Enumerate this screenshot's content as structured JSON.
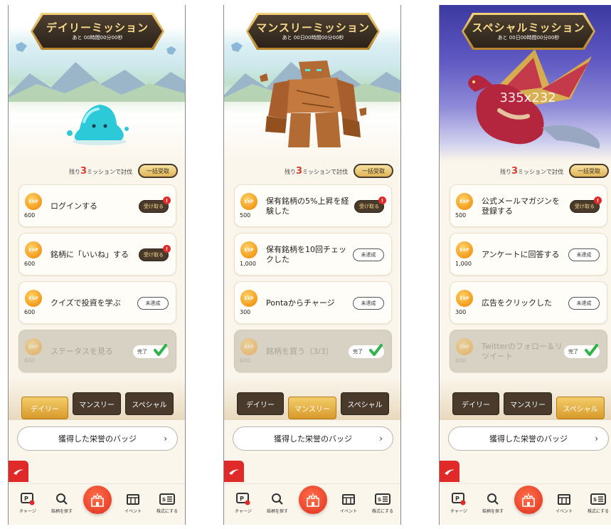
{
  "phones": [
    {
      "banner_title": "デイリーミッション",
      "banner_sub": "あと 00時間00分00秒",
      "remain_prefix": "残り",
      "remain_count": "3",
      "remain_suffix": "ミッションで討伐",
      "bulk_label": "一括受取",
      "missions": [
        {
          "exp": "600",
          "title": "ログインする",
          "status": "受け取る",
          "state": "receive"
        },
        {
          "exp": "600",
          "title": "銘柄に「いいね」する",
          "status": "受け取る",
          "state": "receive"
        },
        {
          "exp": "600",
          "title": "クイズで投資を学ぶ",
          "status": "未達成",
          "state": "pending"
        },
        {
          "exp": "600",
          "title": "ステータスを見る",
          "status": "完了",
          "state": "complete"
        }
      ],
      "active_tab": 0
    },
    {
      "banner_title": "マンスリーミッション",
      "banner_sub": "あと 00日00時間00分00秒",
      "remain_prefix": "残り",
      "remain_count": "3",
      "remain_suffix": "ミッションで討伐",
      "bulk_label": "一括受取",
      "missions": [
        {
          "exp": "500",
          "title": "保有銘柄の5%上昇を経験した",
          "status": "受け取る",
          "state": "receive"
        },
        {
          "exp": "1,000",
          "title": "保有銘柄を10回チェックした",
          "status": "未達成",
          "state": "pending"
        },
        {
          "exp": "300",
          "title": "Pontaからチャージ",
          "status": "未達成",
          "state": "pending"
        },
        {
          "exp": "600",
          "title": "銘柄を買う（3/3）",
          "status": "完了",
          "state": "complete"
        }
      ],
      "active_tab": 1
    },
    {
      "banner_title": "スペシャルミッション",
      "banner_sub": "あと 00日00時間00分00秒",
      "placeholder": "335x232",
      "remain_prefix": "残り",
      "remain_count": "3",
      "remain_suffix": "ミッションで討伐",
      "bulk_label": "一括受取",
      "missions": [
        {
          "exp": "500",
          "title": "公式メールマガジンを登録する",
          "status": "受け取る",
          "state": "receive"
        },
        {
          "exp": "1,000",
          "title": "アンケートに回答する",
          "status": "未達成",
          "state": "pending"
        },
        {
          "exp": "300",
          "title": "広告をクリックした",
          "status": "未達成",
          "state": "pending"
        },
        {
          "exp": "600",
          "title": "Twitterのフォロー＆リツイート",
          "status": "完了",
          "state": "complete"
        }
      ],
      "active_tab": 2
    }
  ],
  "coin_label": "EXP",
  "badge_mark": "!",
  "tabs": [
    "デイリー",
    "マンスリー",
    "スペシャル"
  ],
  "honor_badge_label": "獲得した栄誉のバッジ",
  "chevron": "›",
  "nav": [
    "チャージ",
    "銘柄を探す",
    "ホーム",
    "イベント",
    "株式にする"
  ],
  "colors": {
    "accent_red": "#e02a2a",
    "gold": "#e0b557",
    "dark_brown": "#4a3a2b",
    "background": "#fbf6ec"
  }
}
